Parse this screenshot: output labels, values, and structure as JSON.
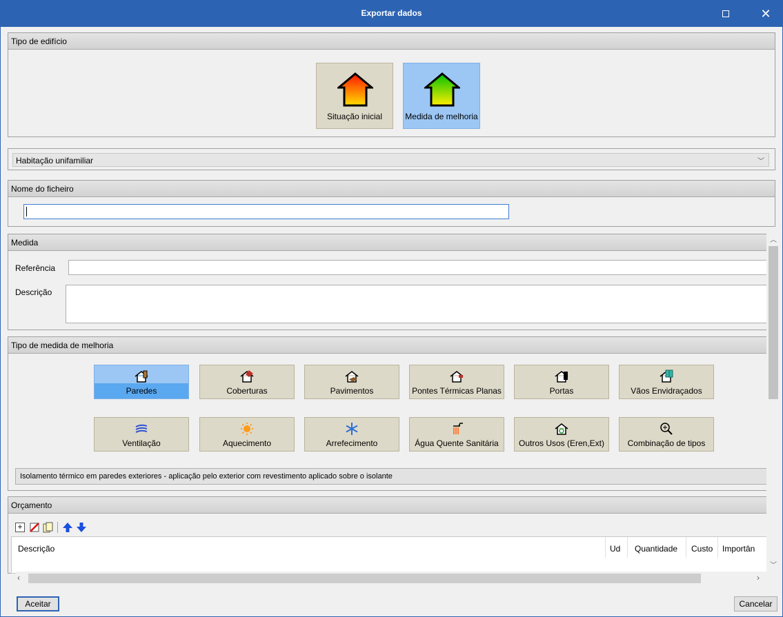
{
  "window": {
    "title": "Exportar dados"
  },
  "building_type": {
    "header": "Tipo de edifício",
    "options": [
      {
        "label": "Situação inicial",
        "selected": false
      },
      {
        "label": "Medida de melhoria",
        "selected": true
      }
    ]
  },
  "usage_select": {
    "value": "Habitação unifamiliar"
  },
  "filename": {
    "header": "Nome do ficheiro",
    "value": ""
  },
  "measure": {
    "header": "Medida",
    "reference_label": "Referência",
    "reference_value": "",
    "description_label": "Descrição",
    "description_value": ""
  },
  "measure_type": {
    "header": "Tipo de medida de melhoria",
    "row1": [
      {
        "label": "Paredes",
        "icon": "walls-icon",
        "selected": true
      },
      {
        "label": "Coberturas",
        "icon": "roof-icon",
        "selected": false
      },
      {
        "label": "Pavimentos",
        "icon": "floor-icon",
        "selected": false
      },
      {
        "label": "Pontes Térmicas Planas",
        "icon": "thermal-bridge-icon",
        "selected": false
      },
      {
        "label": "Portas",
        "icon": "door-icon",
        "selected": false
      },
      {
        "label": "Vãos Envidraçados",
        "icon": "window-icon",
        "selected": false
      }
    ],
    "row2": [
      {
        "label": "Ventilação",
        "icon": "ventilation-icon",
        "selected": false
      },
      {
        "label": "Aquecimento",
        "icon": "heating-icon",
        "selected": false
      },
      {
        "label": "Arrefecimento",
        "icon": "cooling-icon",
        "selected": false
      },
      {
        "label": "Água Quente Sanitária",
        "icon": "shower-icon",
        "selected": false
      },
      {
        "label": "Outros Usos (Eren,Ext)",
        "icon": "recycle-house-icon",
        "selected": false
      },
      {
        "label": "Combinação de tipos",
        "icon": "zoom-icon",
        "selected": false
      }
    ],
    "selected_description": "Isolamento térmico em paredes exteriores - aplicação pelo exterior com revestimento aplicado sobre o isolante"
  },
  "budget": {
    "header": "Orçamento",
    "columns": [
      "Descrição",
      "Ud",
      "Quantidade",
      "Custo",
      "Importân"
    ]
  },
  "footer": {
    "accept": "Aceitar",
    "cancel": "Cancelar"
  },
  "colors": {
    "titlebar": "#2d63b3",
    "selected": "#9cc7f5",
    "button": "#ddd9c8"
  }
}
